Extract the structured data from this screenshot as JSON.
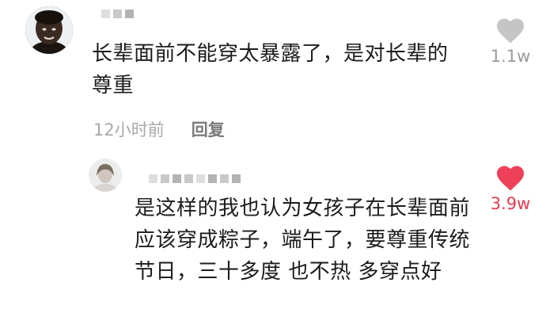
{
  "main_comment": {
    "text": "长辈面前不能穿太暴露了，是对长辈的尊重",
    "time": "12小时前",
    "reply_label": "回复",
    "likes": "1.1w",
    "liked": false
  },
  "reply": {
    "text": "是这样的我也认为女孩子在长辈面前应该穿成粽子，端午了，要尊重传统节日，三十多度 也不热 多穿点好",
    "likes": "3.9w",
    "liked": true
  },
  "colors": {
    "like_inactive": "#c5c5c5",
    "like_active": "#ee4058"
  },
  "icons": {
    "like": "heart-icon"
  }
}
